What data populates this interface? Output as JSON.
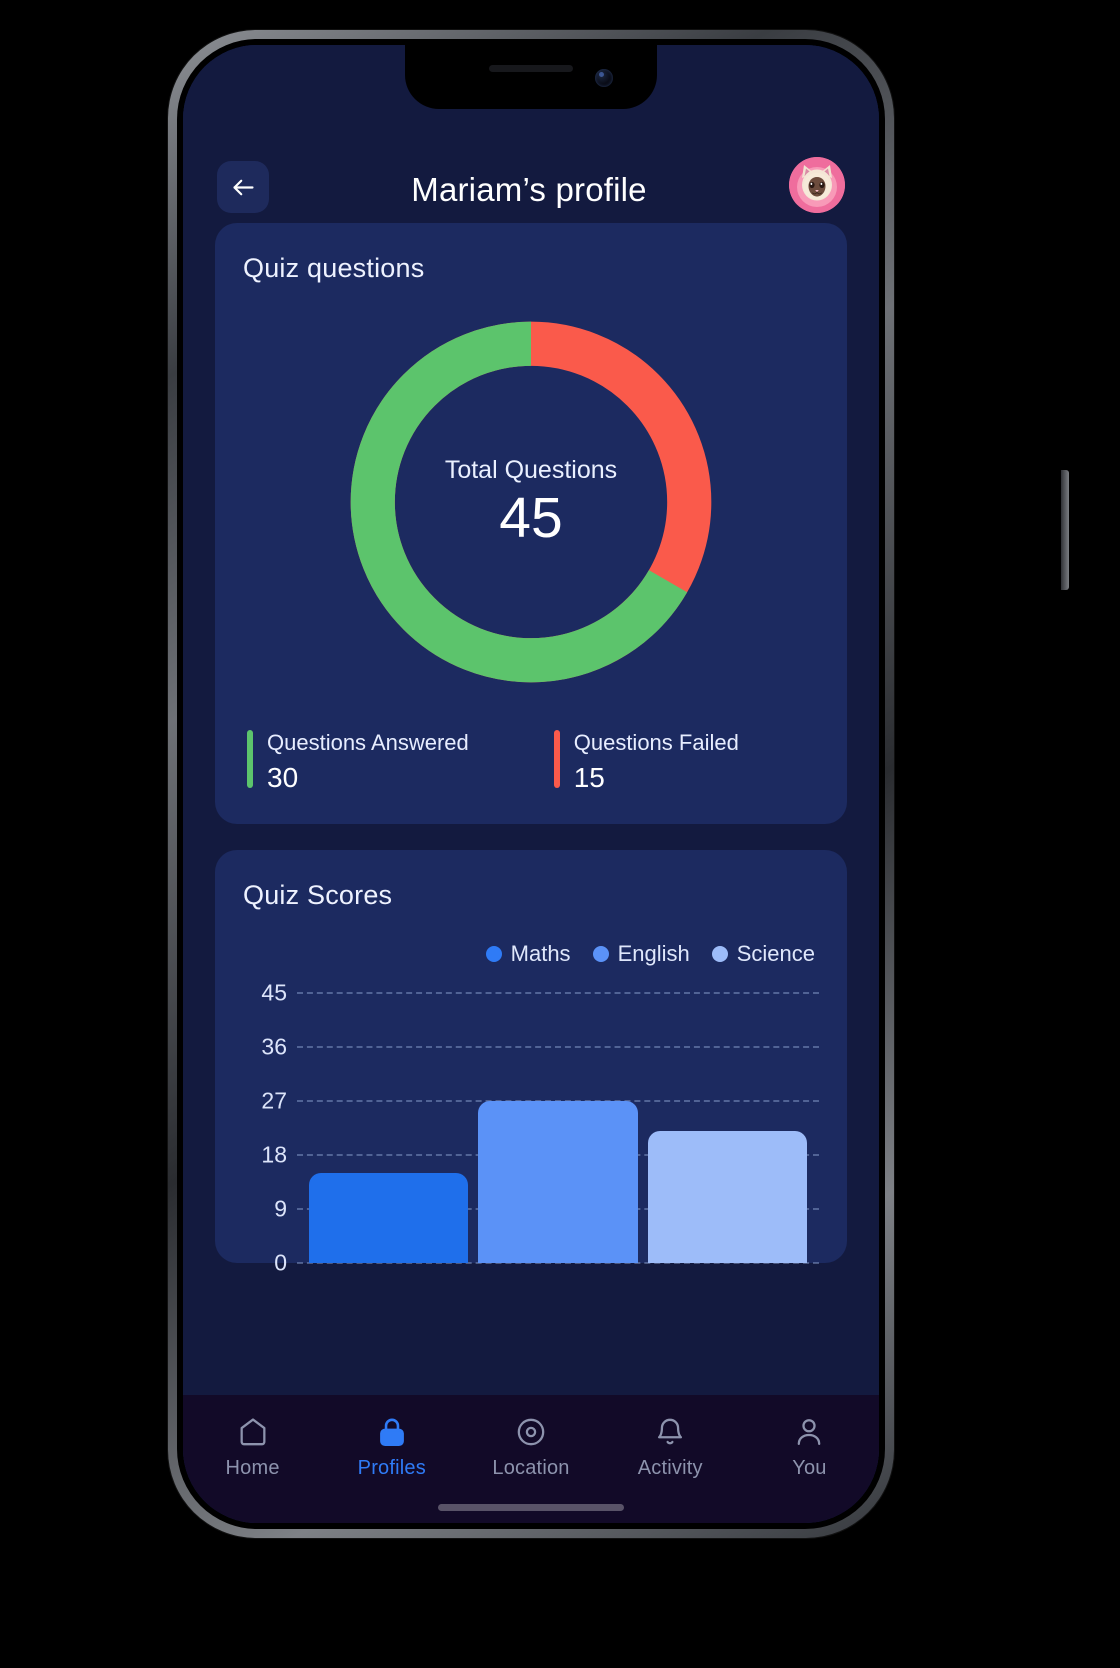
{
  "header": {
    "title": "Mariam’s profile",
    "back_icon": "arrow-left-icon",
    "avatar_icon": "cat-avatar-icon"
  },
  "quiz_questions_card": {
    "title": "Quiz questions",
    "donut": {
      "center_label": "Total Questions",
      "center_value": "45"
    },
    "legend": [
      {
        "name": "Questions Answered",
        "value": "30",
        "color": "#5cc46c"
      },
      {
        "name": "Questions Failed",
        "value": "15",
        "color": "#fa5a4b"
      }
    ]
  },
  "quiz_scores_card": {
    "title": "Quiz Scores"
  },
  "chart_data": {
    "type": "bar",
    "title": "Quiz Scores",
    "categories": [
      "Maths",
      "English",
      "Science"
    ],
    "values": [
      15,
      27,
      22
    ],
    "series": [
      {
        "name": "Maths",
        "values": [
          15
        ],
        "color": "#1f6feb"
      },
      {
        "name": "English",
        "values": [
          27
        ],
        "color": "#5b92f7"
      },
      {
        "name": "Science",
        "values": [
          22
        ],
        "color": "#9dbcf9"
      }
    ],
    "legend": [
      "Maths",
      "English",
      "Science"
    ],
    "legend_position": "top-right",
    "xlabel": "",
    "ylabel": "",
    "yticks": [
      "45",
      "36",
      "27",
      "18",
      "9",
      "0"
    ],
    "ylim": [
      0,
      45
    ],
    "grid": true
  },
  "donut_data": {
    "type": "pie",
    "title": "Quiz questions",
    "categories": [
      "Questions Answered",
      "Questions Failed"
    ],
    "values": [
      30,
      15
    ],
    "colors": [
      "#5cc46c",
      "#fa5a4b"
    ],
    "total": 45
  },
  "bottom_nav": {
    "items": [
      {
        "label": "Home",
        "icon": "home-icon",
        "active": false
      },
      {
        "label": "Profiles",
        "icon": "lock-icon",
        "active": true
      },
      {
        "label": "Location",
        "icon": "location-target-icon",
        "active": false
      },
      {
        "label": "Activity",
        "icon": "bell-icon",
        "active": false
      },
      {
        "label": "You",
        "icon": "person-icon",
        "active": false
      }
    ]
  },
  "colors": {
    "screen_bg": "#131a3f",
    "card_bg": "#1c2a60",
    "accent": "#2f7bf6",
    "nav_bg": "#120a28",
    "success": "#5cc46c",
    "danger": "#fa5a4b"
  }
}
